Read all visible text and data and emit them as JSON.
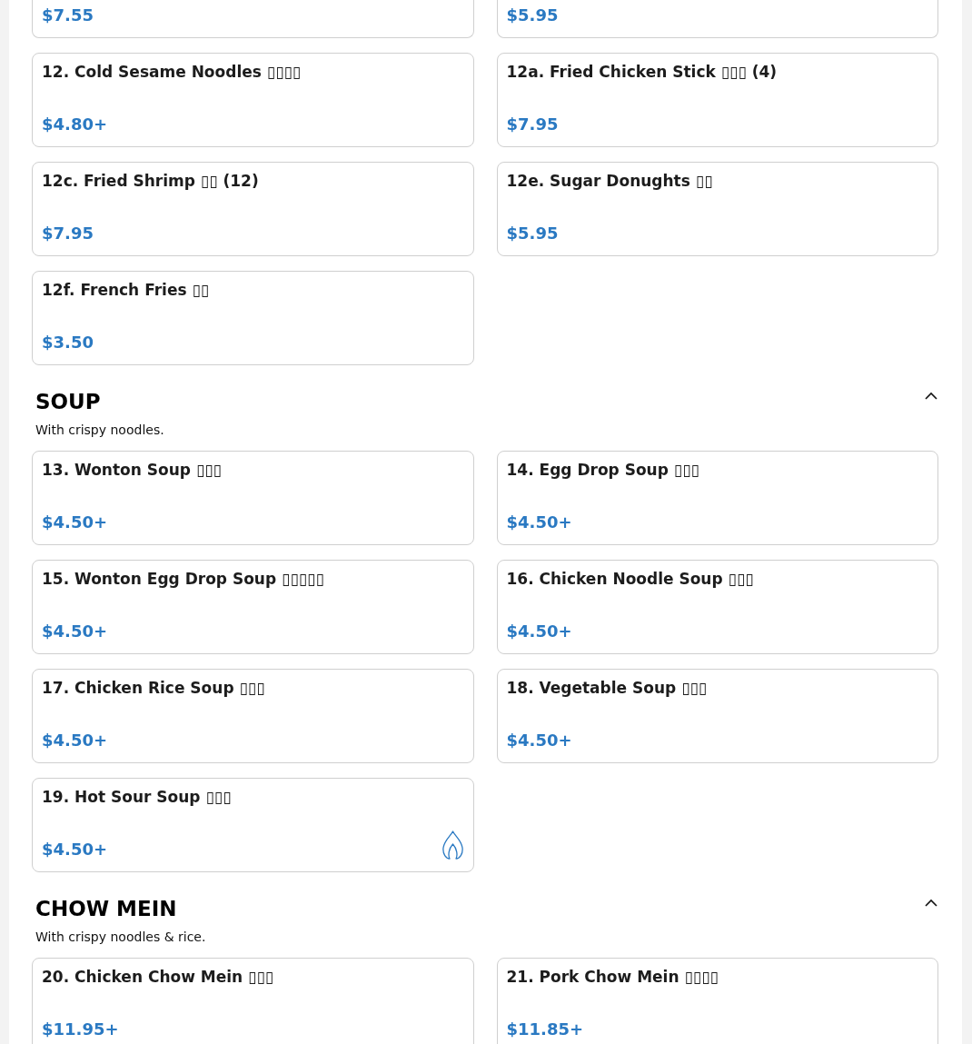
{
  "menu": {
    "sections": [
      {
        "items": [
          {
            "price": "$7.55",
            "spicy": false
          },
          {
            "price": "$5.95",
            "spicy": false
          },
          {
            "name": "12. Cold Sesame Noodles ▯▯▯▯",
            "price": "$4.80+",
            "spicy": false
          },
          {
            "name": "12a. Fried Chicken Stick ▯▯▯ (4)",
            "price": "$7.95",
            "spicy": false
          },
          {
            "name": "12c. Fried Shrimp ▯▯ (12)",
            "price": "$7.95",
            "spicy": false
          },
          {
            "name": "12e. Sugar Donughts ▯▯",
            "price": "$5.95",
            "spicy": false
          },
          {
            "name": "12f. French Fries ▯▯",
            "price": "$3.50",
            "spicy": false
          }
        ]
      },
      {
        "heading": "SOUP",
        "description": "With crispy noodles.",
        "expanded": true,
        "items": [
          {
            "name": "13. Wonton Soup ▯▯▯",
            "price": "$4.50+",
            "spicy": false
          },
          {
            "name": "14. Egg Drop Soup ▯▯▯",
            "price": "$4.50+",
            "spicy": false
          },
          {
            "name": "15. Wonton Egg Drop Soup ▯▯▯▯▯",
            "price": "$4.50+",
            "spicy": false
          },
          {
            "name": "16. Chicken Noodle Soup ▯▯▯",
            "price": "$4.50+",
            "spicy": false
          },
          {
            "name": "17. Chicken Rice Soup ▯▯▯",
            "price": "$4.50+",
            "spicy": false
          },
          {
            "name": "18. Vegetable Soup ▯▯▯",
            "price": "$4.50+",
            "spicy": false
          },
          {
            "name": "19. Hot Sour Soup ▯▯▯",
            "price": "$4.50+",
            "spicy": true
          }
        ]
      },
      {
        "heading": "CHOW MEIN",
        "description": "With crispy noodles & rice.",
        "expanded": true,
        "items": [
          {
            "name": "20. Chicken Chow Mein ▯▯▯",
            "price": "$11.95+",
            "spicy": false
          },
          {
            "name": "21. Pork Chow Mein ▯▯▯▯",
            "price": "$11.85+",
            "spicy": false
          }
        ]
      }
    ]
  }
}
